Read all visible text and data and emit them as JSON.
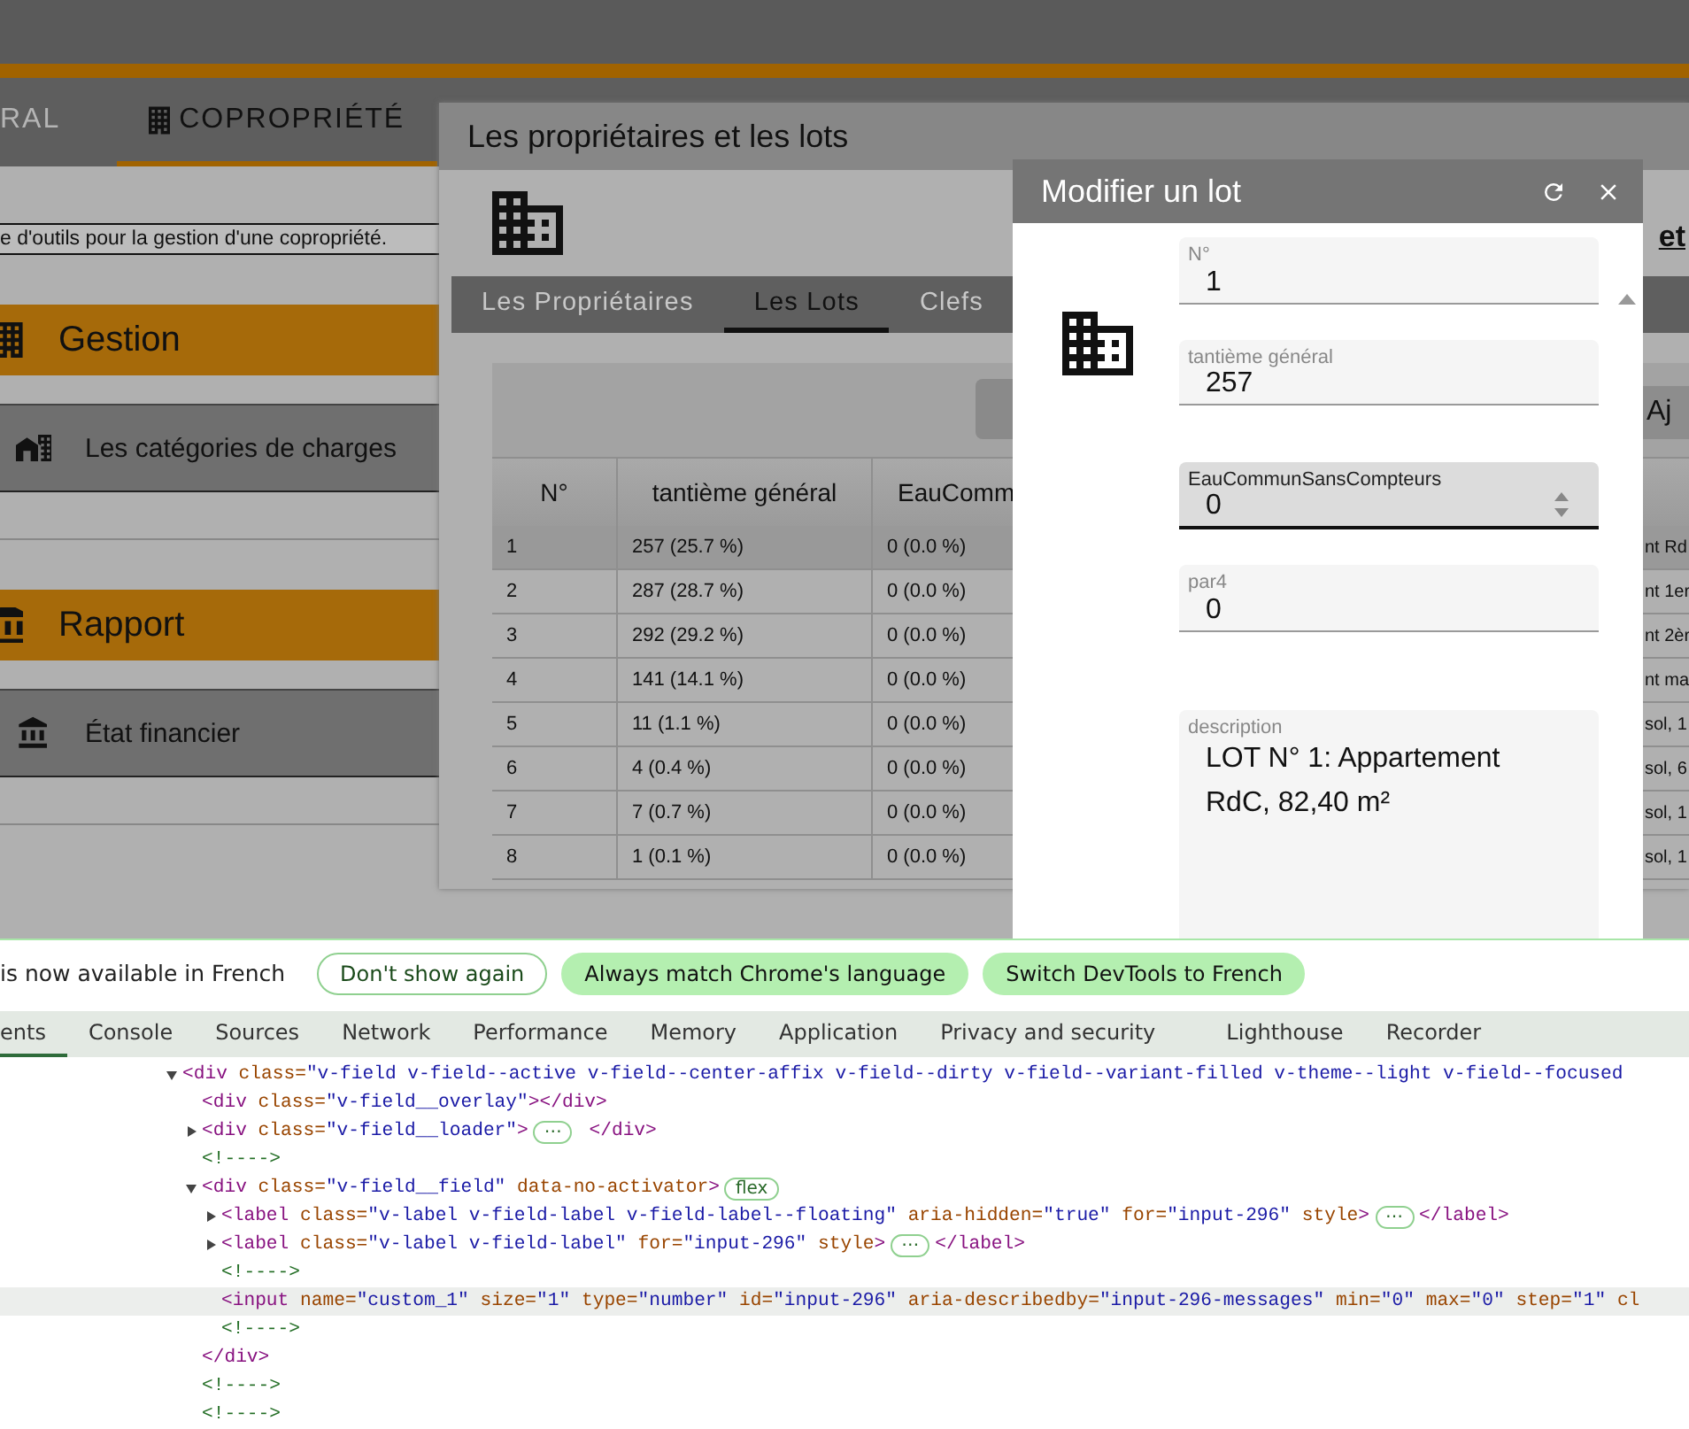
{
  "top_tabs": [
    {
      "label": "RAL",
      "selected": false,
      "icon": false
    },
    {
      "label": "COPROPRIÉTÉ",
      "selected": true,
      "icon": true
    }
  ],
  "intro": "e d'outils pour la gestion d'une copropriété.",
  "sections": [
    {
      "title": "Gestion",
      "kind": "building",
      "items": [
        {
          "label": "Les catégories de charges",
          "kind": "city"
        }
      ]
    },
    {
      "title": "Rapport",
      "kind": "bank",
      "items": [
        {
          "label": "État financier",
          "kind": "bank"
        }
      ]
    }
  ],
  "panel": {
    "title": "Les propriétaires et les lots",
    "link": "et",
    "tabs": [
      {
        "label": "Les Propriétaires",
        "selected": false
      },
      {
        "label": "Les Lots",
        "selected": true
      },
      {
        "label": "Clefs",
        "selected": false
      }
    ],
    "add_button": "Aj",
    "table": {
      "columns": [
        "N°",
        "tantième général",
        "EauComm"
      ],
      "rows": [
        {
          "cells": [
            "1",
            "257 (25.7 %)",
            "0 (0.0 %)",
            "nt Rd"
          ],
          "selected": true
        },
        {
          "cells": [
            "2",
            "287 (28.7 %)",
            "0 (0.0 %)",
            "nt 1er"
          ],
          "selected": false
        },
        {
          "cells": [
            "3",
            "292 (29.2 %)",
            "0 (0.0 %)",
            "nt 2èr"
          ],
          "selected": false
        },
        {
          "cells": [
            "4",
            "141 (14.1 %)",
            "0 (0.0 %)",
            "nt ma"
          ],
          "selected": false
        },
        {
          "cells": [
            "5",
            "11 (1.1 %)",
            "0 (0.0 %)",
            "sol, 1"
          ],
          "selected": false
        },
        {
          "cells": [
            "6",
            "4 (0.4 %)",
            "0 (0.0 %)",
            "sol, 6"
          ],
          "selected": false
        },
        {
          "cells": [
            "7",
            "7 (0.7 %)",
            "0 (0.0 %)",
            "sol, 1"
          ],
          "selected": false
        },
        {
          "cells": [
            "8",
            "1 (0.1 %)",
            "0 (0.0 %)",
            "sol, 1"
          ],
          "selected": false
        }
      ]
    }
  },
  "dialog": {
    "title": "Modifier un lot",
    "fields": [
      {
        "kind": "input",
        "label": "N°",
        "value": "1",
        "focused": false
      },
      {
        "kind": "input",
        "label": "tantième général",
        "value": "257",
        "focused": false
      },
      {
        "kind": "input",
        "label": "EauCommunSansCompteurs",
        "value": "0",
        "focused": true
      },
      {
        "kind": "input",
        "label": "par4",
        "value": "0",
        "focused": false
      },
      {
        "kind": "textarea",
        "label": "description",
        "value": "LOT N° 1: Appartement RdC, 82,40 m²",
        "focused": false
      }
    ]
  },
  "devtools": {
    "infobar": {
      "message": "is now available in French",
      "buttons": [
        {
          "label": "Don't show again",
          "primary": false
        },
        {
          "label": "Always match Chrome's language",
          "primary": true
        },
        {
          "label": "Switch DevTools to French",
          "primary": true
        }
      ]
    },
    "tabs": [
      {
        "label": "ents",
        "selected": true
      },
      {
        "label": "Console",
        "selected": false
      },
      {
        "label": "Sources",
        "selected": false
      },
      {
        "label": "Network",
        "selected": false
      },
      {
        "label": "Performance",
        "selected": false
      },
      {
        "label": "Memory",
        "selected": false
      },
      {
        "label": "Application",
        "selected": false
      },
      {
        "label": "Privacy and security",
        "selected": false
      },
      {
        "label": "Lighthouse",
        "selected": false
      },
      {
        "label": "Recorder",
        "selected": false
      }
    ],
    "dom_tree": [
      {
        "expanded": true,
        "selected": false,
        "segments": [
          {
            "kind": "tag",
            "text": "<div"
          },
          {
            "kind": "attr",
            "text": " class="
          },
          {
            "kind": "value",
            "text": "\"v-field v-field--active v-field--center-affix v-field--dirty v-field--variant-filled v-theme--light v-field--focused"
          }
        ],
        "children": [
          {
            "selected": false,
            "segments": [
              {
                "kind": "tag",
                "text": "<div"
              },
              {
                "kind": "attr",
                "text": " class="
              },
              {
                "kind": "value",
                "text": "\"v-field__overlay\""
              },
              {
                "kind": "tag",
                "text": "></div>"
              }
            ]
          },
          {
            "expanded": false,
            "selected": false,
            "segments": [
              {
                "kind": "tag",
                "text": "<div"
              },
              {
                "kind": "attr",
                "text": " class="
              },
              {
                "kind": "value",
                "text": "\"v-field__loader\""
              },
              {
                "kind": "tag",
                "text": ">"
              },
              {
                "kind": "badge",
                "text": "⋯"
              },
              {
                "kind": "tag",
                "text": " </div>"
              }
            ]
          },
          {
            "selected": false,
            "segments": [
              {
                "kind": "comment",
                "text": "<!---->"
              }
            ]
          },
          {
            "expanded": true,
            "selected": false,
            "segments": [
              {
                "kind": "tag",
                "text": "<div"
              },
              {
                "kind": "attr",
                "text": " class="
              },
              {
                "kind": "value",
                "text": "\"v-field__field\""
              },
              {
                "kind": "attr",
                "text": " data-no-activator"
              },
              {
                "kind": "tag",
                "text": ">"
              },
              {
                "kind": "badge",
                "text": "flex"
              }
            ],
            "close": "</div>",
            "children": [
              {
                "expanded": false,
                "selected": false,
                "segments": [
                  {
                    "kind": "tag",
                    "text": "<label"
                  },
                  {
                    "kind": "attr",
                    "text": " class="
                  },
                  {
                    "kind": "value",
                    "text": "\"v-label v-field-label v-field-label--floating\""
                  },
                  {
                    "kind": "attr",
                    "text": " aria-hidden="
                  },
                  {
                    "kind": "value",
                    "text": "\"true\""
                  },
                  {
                    "kind": "attr",
                    "text": " for="
                  },
                  {
                    "kind": "value",
                    "text": "\"input-296\""
                  },
                  {
                    "kind": "attr",
                    "text": " style"
                  },
                  {
                    "kind": "tag",
                    "text": ">"
                  },
                  {
                    "kind": "badge",
                    "text": "⋯"
                  },
                  {
                    "kind": "tag",
                    "text": "</label>"
                  }
                ]
              },
              {
                "expanded": false,
                "selected": false,
                "segments": [
                  {
                    "kind": "tag",
                    "text": "<label"
                  },
                  {
                    "kind": "attr",
                    "text": " class="
                  },
                  {
                    "kind": "value",
                    "text": "\"v-label v-field-label\""
                  },
                  {
                    "kind": "attr",
                    "text": " for="
                  },
                  {
                    "kind": "value",
                    "text": "\"input-296\""
                  },
                  {
                    "kind": "attr",
                    "text": " style"
                  },
                  {
                    "kind": "tag",
                    "text": ">"
                  },
                  {
                    "kind": "badge",
                    "text": "⋯"
                  },
                  {
                    "kind": "tag",
                    "text": "</label>"
                  }
                ]
              },
              {
                "selected": false,
                "segments": [
                  {
                    "kind": "comment",
                    "text": "<!---->"
                  }
                ]
              },
              {
                "selected": true,
                "segments": [
                  {
                    "kind": "tag",
                    "text": "<input"
                  },
                  {
                    "kind": "attr",
                    "text": " name="
                  },
                  {
                    "kind": "value",
                    "text": "\"custom_1\""
                  },
                  {
                    "kind": "attr",
                    "text": " size="
                  },
                  {
                    "kind": "value",
                    "text": "\"1\""
                  },
                  {
                    "kind": "attr",
                    "text": " type="
                  },
                  {
                    "kind": "value",
                    "text": "\"number\""
                  },
                  {
                    "kind": "attr",
                    "text": " id="
                  },
                  {
                    "kind": "value",
                    "text": "\"input-296\""
                  },
                  {
                    "kind": "attr",
                    "text": " aria-describedby="
                  },
                  {
                    "kind": "value",
                    "text": "\"input-296-messages\""
                  },
                  {
                    "kind": "attr",
                    "text": " min="
                  },
                  {
                    "kind": "value",
                    "text": "\"0\""
                  },
                  {
                    "kind": "attr",
                    "text": " max="
                  },
                  {
                    "kind": "value",
                    "text": "\"0\""
                  },
                  {
                    "kind": "attr",
                    "text": " step="
                  },
                  {
                    "kind": "value",
                    "text": "\"1\""
                  },
                  {
                    "kind": "attr",
                    "text": " cl"
                  }
                ]
              },
              {
                "selected": false,
                "segments": [
                  {
                    "kind": "comment",
                    "text": "<!---->"
                  }
                ]
              }
            ]
          },
          {
            "selected": false,
            "segments": [
              {
                "kind": "comment",
                "text": "<!---->"
              }
            ]
          },
          {
            "selected": false,
            "segments": [
              {
                "kind": "comment",
                "text": "<!---->"
              }
            ]
          }
        ]
      }
    ]
  }
}
